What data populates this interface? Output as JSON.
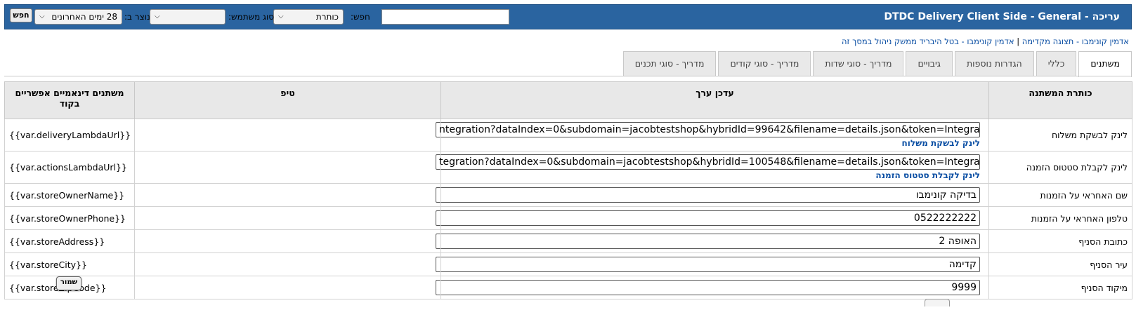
{
  "header": {
    "title": "עריכה - DTDC Delivery Client Side - General",
    "search_label": "חפש:",
    "search_value": "",
    "field_select_value": "כותרת",
    "user_type_label": "סוג משתמש:",
    "user_type_value": "",
    "created_label": "נוצר ב:",
    "created_value": "28 ימים האחרונים",
    "search_button": "חפש"
  },
  "breadcrumb": {
    "link1": "אדמין קונימבו - תצוגה מקדימה",
    "separator": "|",
    "link2": "אדמין קונימבו - בטל היבריד ממשק ניהול במסך זה"
  },
  "tabs": [
    {
      "label": "משתנים",
      "active": true
    },
    {
      "label": "כללי"
    },
    {
      "label": "הגדרות נוספות"
    },
    {
      "label": "גיבויים"
    },
    {
      "label": "מדריך - סוגי שדות"
    },
    {
      "label": "מדריך - סוגי קודים"
    },
    {
      "label": "מדריך - סוגי תכנים"
    }
  ],
  "table": {
    "headers": {
      "title": "כותרת המשתנה",
      "edit": "עדכן ערך",
      "tip": "טיפ",
      "vars": "משתנים דינאמיים אפשריים בקוד"
    },
    "rows": [
      {
        "label": "לינק לבשקת משלוח",
        "value": "ntegration?dataIndex=0&subdomain=jacobtestshop&hybridId=99642&filename=details.json&token=Integration Token",
        "link": "לינק לבשקת משלוח",
        "tip": "",
        "var": "{{var.deliveryLambdaUrl}}"
      },
      {
        "label": "לינק לקבלת סטטוס הזמנה",
        "value": "tegration?dataIndex=0&subdomain=jacobtestshop&hybridId=100548&filename=details.json&token=Integration Token",
        "link": "לינק לקבלת סטטוס הזמנה",
        "tip": "",
        "var": "{{var.actionsLambdaUrl}}"
      },
      {
        "label": "שם האחראי על הזמנות",
        "value": "בדיקה קונימבו",
        "tip": "",
        "var": "{{var.storeOwnerName}}"
      },
      {
        "label": "טלפון האחראי על הזמנות",
        "value": "0522222222",
        "tip": "",
        "var": "{{var.storeOwnerPhone}}"
      },
      {
        "label": "כתובת הסניף",
        "value": "האופה 2",
        "tip": "",
        "var": "{{var.storeAddress}}"
      },
      {
        "label": "עיר הסניף",
        "value": "קדימה",
        "tip": "",
        "var": "{{var.storeCity}}"
      },
      {
        "label": "מיקוד הסניף",
        "value": "9999",
        "tip": "",
        "var": "{{var.storeZipCode}}"
      }
    ]
  },
  "save_button": "שמור",
  "colors": {
    "header_bg": "#2a64a0",
    "link": "#0a4ea3",
    "table_header_bg": "#e8e8e8"
  }
}
